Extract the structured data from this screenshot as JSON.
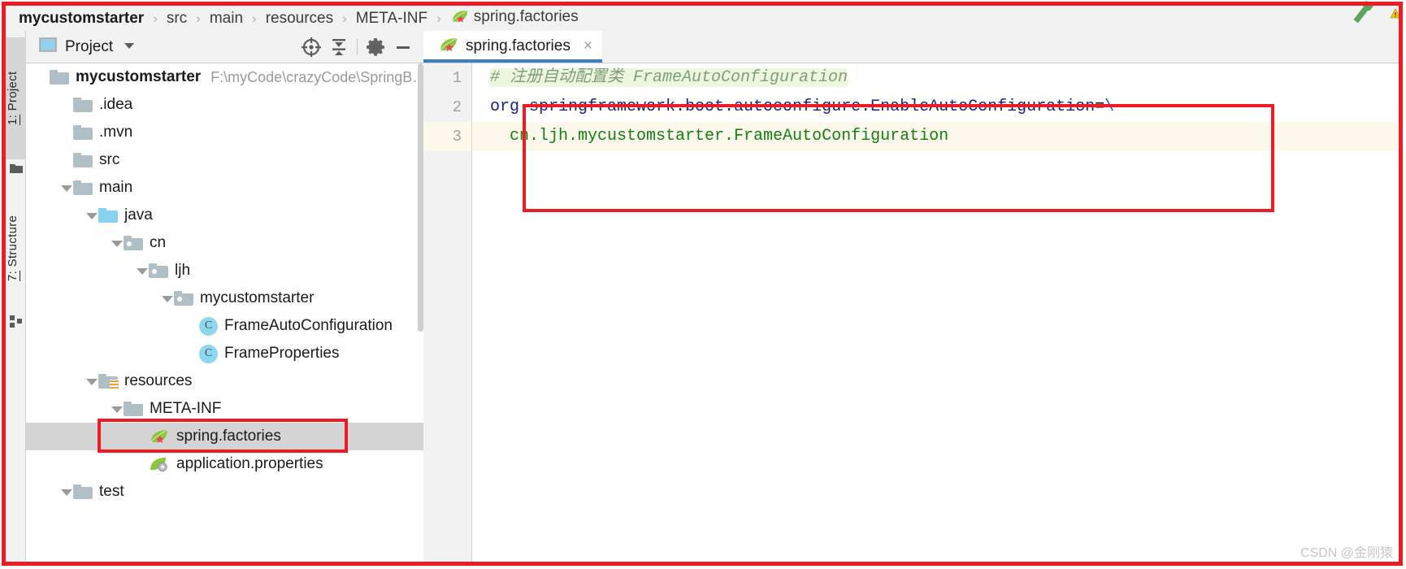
{
  "breadcrumb": {
    "items": [
      {
        "label": "mycustomstarter",
        "bold": true,
        "icon": null
      },
      {
        "label": "src",
        "bold": false,
        "icon": null
      },
      {
        "label": "main",
        "bold": false,
        "icon": null
      },
      {
        "label": "resources",
        "bold": false,
        "icon": null
      },
      {
        "label": "META-INF",
        "bold": false,
        "icon": null
      },
      {
        "label": "spring.factories",
        "bold": false,
        "icon": "spring-leaf-icon"
      }
    ],
    "separator": "›",
    "wrench_icon": "wrench-icon",
    "warning_badge": "⚠"
  },
  "toolstrip": {
    "tabs": [
      {
        "num": "1:",
        "label": " Project",
        "active": true,
        "icon": "project-window-icon"
      },
      {
        "num": "7:",
        "label": " Structure",
        "active": false,
        "icon": "structure-icon"
      }
    ]
  },
  "project_panel": {
    "toolbar": {
      "title": "Project",
      "view_icon": "project-view-icon",
      "dropdown_icon": "chevron-down-icon",
      "locate_icon": "target-crosshair-icon",
      "collapse_icon": "collapse-all-icon",
      "settings_icon": "gear-icon",
      "hide_icon": "minimize-icon"
    },
    "tree": [
      {
        "label": "mycustomstarter",
        "path": "F:\\myCode\\crazyCode\\SpringB…",
        "indent": 0,
        "icon": "module-icon",
        "twisty": "",
        "bold": true,
        "selected": false
      },
      {
        "label": ".idea",
        "path": "",
        "indent": 1,
        "icon": "folder-icon",
        "twisty": "",
        "bold": false,
        "selected": false
      },
      {
        "label": ".mvn",
        "path": "",
        "indent": 1,
        "icon": "folder-icon",
        "twisty": "",
        "bold": false,
        "selected": false
      },
      {
        "label": "src",
        "path": "",
        "indent": 1,
        "icon": "folder-icon",
        "twisty": "",
        "bold": false,
        "selected": false
      },
      {
        "label": "main",
        "path": "",
        "indent": 1,
        "icon": "folder-icon",
        "twisty": "open",
        "bold": false,
        "selected": false
      },
      {
        "label": "java",
        "path": "",
        "indent": 2,
        "icon": "source-folder-icon",
        "twisty": "open",
        "bold": false,
        "selected": false
      },
      {
        "label": "cn",
        "path": "",
        "indent": 3,
        "icon": "package-icon",
        "twisty": "open",
        "bold": false,
        "selected": false
      },
      {
        "label": "ljh",
        "path": "",
        "indent": 4,
        "icon": "package-icon",
        "twisty": "open",
        "bold": false,
        "selected": false
      },
      {
        "label": "mycustomstarter",
        "path": "",
        "indent": 5,
        "icon": "package-icon",
        "twisty": "open",
        "bold": false,
        "selected": false
      },
      {
        "label": "FrameAutoConfiguration",
        "path": "",
        "indent": 6,
        "icon": "java-class-icon",
        "twisty": "",
        "bold": false,
        "selected": false
      },
      {
        "label": "FrameProperties",
        "path": "",
        "indent": 6,
        "icon": "java-class-icon",
        "twisty": "",
        "bold": false,
        "selected": false
      },
      {
        "label": "resources",
        "path": "",
        "indent": 2,
        "icon": "resources-folder-icon",
        "twisty": "open",
        "bold": false,
        "selected": false
      },
      {
        "label": "META-INF",
        "path": "",
        "indent": 3,
        "icon": "folder-icon",
        "twisty": "open",
        "bold": false,
        "selected": false
      },
      {
        "label": "spring.factories",
        "path": "",
        "indent": 4,
        "icon": "spring-leaf-icon",
        "twisty": "",
        "bold": false,
        "selected": true
      },
      {
        "label": "application.properties",
        "path": "",
        "indent": 4,
        "icon": "spring-properties-icon",
        "twisty": "",
        "bold": false,
        "selected": false
      },
      {
        "label": "test",
        "path": "",
        "indent": 1,
        "icon": "folder-icon",
        "twisty": "open",
        "bold": false,
        "selected": false
      }
    ],
    "class_icon_letter": "C"
  },
  "editor": {
    "tab": {
      "label": "spring.factories",
      "icon": "spring-leaf-icon",
      "close_icon": "×"
    },
    "line_numbers": [
      "1",
      "2",
      "3"
    ],
    "lines": [
      {
        "n": 1,
        "current": false,
        "tokens": [
          {
            "t": "# 注册自动配置类 FrameAutoConfiguration",
            "c": "cmt"
          }
        ]
      },
      {
        "n": 2,
        "current": false,
        "tokens": [
          {
            "t": "org.springframework.boot.autoconfigure.EnableAutoConfiguration",
            "c": "key"
          },
          {
            "t": "=",
            "c": "op"
          },
          {
            "t": "\\",
            "c": "bs"
          }
        ]
      },
      {
        "n": 3,
        "current": true,
        "tokens": [
          {
            "t": "  cn.ljh.mycustomstarter.FrameAutoConfiguration",
            "c": "val"
          }
        ]
      }
    ]
  },
  "annotations": {
    "code_redbox": "red-highlight-box-code",
    "tree_redbox": "red-highlight-box-tree",
    "outer_redbox": "red-outer-frame"
  },
  "watermark": "CSDN @金刚猿",
  "colors": {
    "accent_blue": "#3c7ec1",
    "annotation_red": "#ed1c24",
    "comment_green": "#7f9f7f",
    "value_green": "#138013",
    "key_navy": "#1a237e",
    "selection_gray": "#d4d4d4"
  }
}
